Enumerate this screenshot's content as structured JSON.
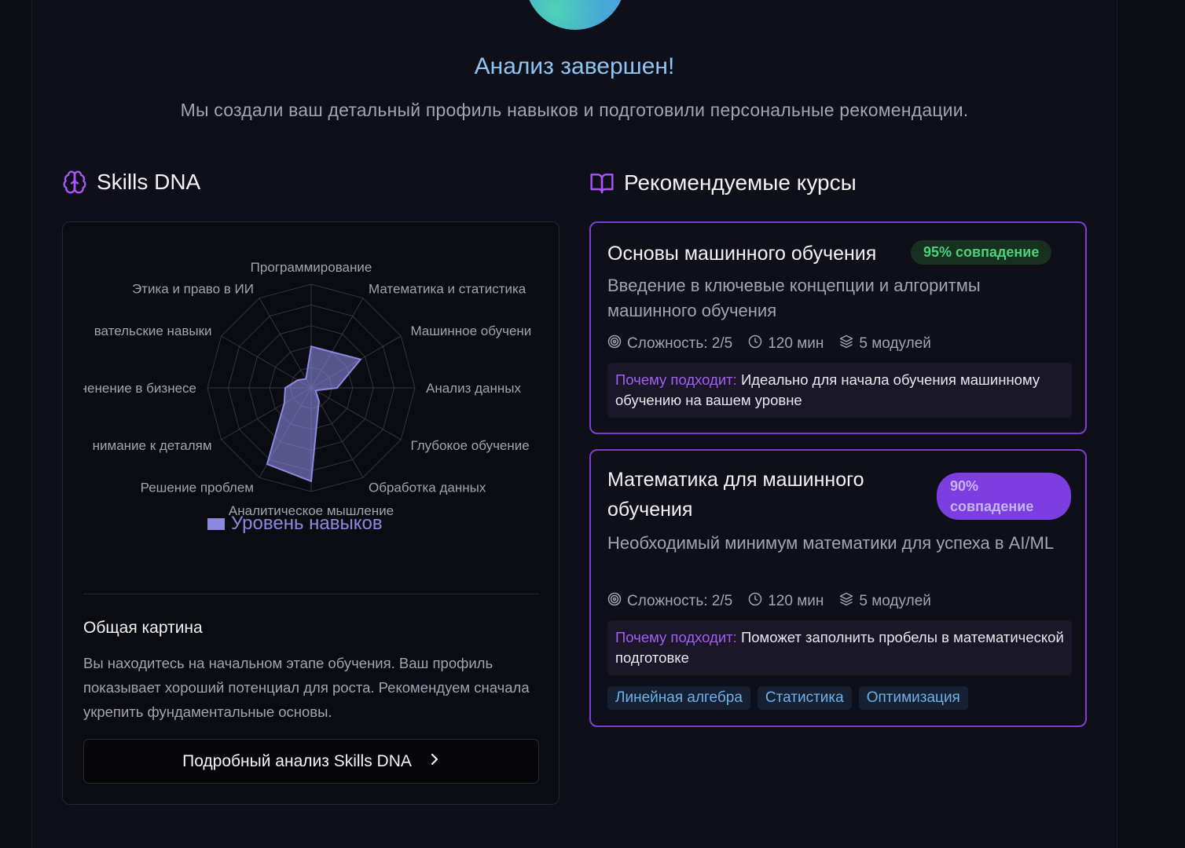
{
  "hero": {
    "title": "Анализ завершен!",
    "subtitle": "Мы создали ваш детальный профиль навыков и подготовили персональные рекомендации."
  },
  "skills_section": {
    "title": "Skills DNA",
    "icon": "brain-icon"
  },
  "courses_section": {
    "title": "Рекомендуемые курсы",
    "icon": "book-open-icon"
  },
  "chart_data": {
    "type": "radar",
    "categories": [
      "Программирование",
      "Математика и статистика",
      "Машинное обучение",
      "Анализ данных",
      "Глубокое обучение",
      "Обработка данных",
      "Аналитическое мышление",
      "Решение проблем",
      "Внимание к деталям",
      "Применение в бизнесе",
      "Исследовательские навыки",
      "Этика и право в ИИ"
    ],
    "category_labels_shown": [
      "Программирование",
      "Математика и статистика",
      "Машинное обучени",
      "Анализ данных",
      "Глубокое обучение",
      "Обработка данных",
      "Аналитическое мышление",
      "Решение проблем",
      "нимание к деталям",
      "ненение в бизнесе",
      "вательские навыки",
      "Этика и право в ИИ"
    ],
    "series": [
      {
        "name": "Уровень навыков",
        "values": [
          40,
          40,
          55,
          25,
          5,
          15,
          90,
          85,
          30,
          25,
          15,
          10
        ]
      }
    ],
    "rmax": 100,
    "rings": 5,
    "grid": true,
    "legend": "bottom",
    "color": "#8b88e0"
  },
  "overview": {
    "title": "Общая картина",
    "text": "Вы находитесь на начальном этапе обучения. Ваш профиль показывает хороший потенциал для роста. Рекомендуем сначала укрепить фундаментальные основы."
  },
  "details_button": {
    "label": "Подробный анализ Skills DNA"
  },
  "courses": [
    {
      "title": "Основы машинного обучения",
      "match": "95% совпадение",
      "description": "Введение в ключевые концепции и алгоритмы машинного обучения",
      "difficulty": "Сложность: 2/5",
      "duration": "120 мин",
      "modules": "5 модулей",
      "why_label": "Почему подходит:",
      "why_text": "Идеально для начала обучения машинному обучению на вашем уровне"
    },
    {
      "title": "Математика для машинного обучения",
      "match": "90% совпадение",
      "description": "Необходимый минимум математики для успеха в AI/ML",
      "difficulty": "Сложность: 2/5",
      "duration": "120 мин",
      "modules": "5 модулей",
      "why_label": "Почему подходит:",
      "why_text": "Поможет заполнить пробелы в математической подготовке",
      "tags": [
        "Линейная алгебра",
        "Статистика",
        "Оптимизация"
      ]
    }
  ],
  "colors": {
    "accent": "#7b3ed1",
    "match_green": "#4ad27a",
    "hero_title": "#8ec5f2",
    "tag_text": "#6fb0e8"
  }
}
